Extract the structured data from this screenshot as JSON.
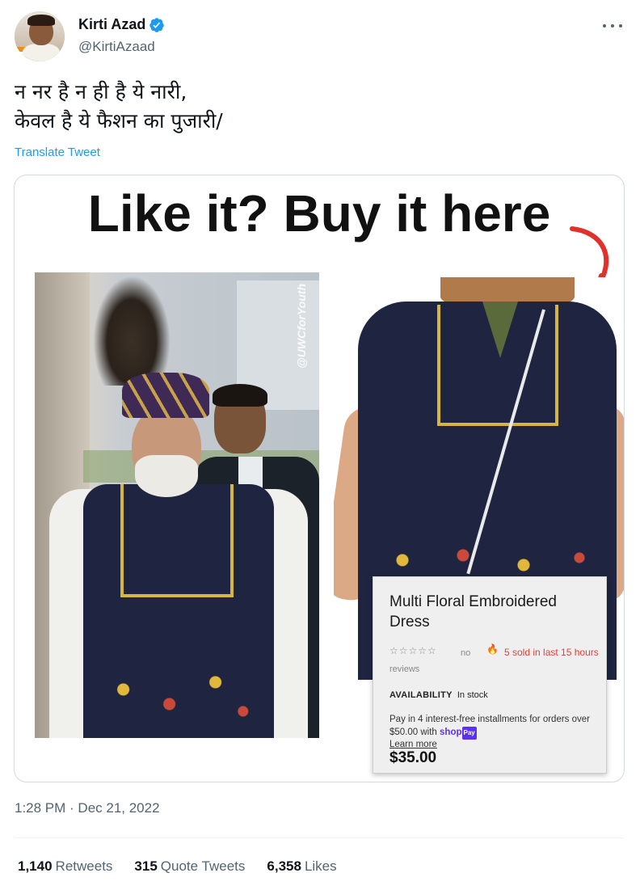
{
  "author": {
    "display_name": "Kirti Azad",
    "handle": "@KirtiAzaad",
    "verified": true,
    "avatar": "avatar-image"
  },
  "tweet": {
    "text_line1": "न नर है न ही है ये नारी,",
    "text_line2": "केवल है ये फैशन का पुजारी/",
    "translate_label": "Translate Tweet",
    "timestamp": "1:28 PM · Dec 21, 2022"
  },
  "media": {
    "headline": "Like it? Buy it here",
    "watermark": "@UWCforYouth",
    "product": {
      "title": "Multi Floral Embroidered Dress",
      "stars": "☆☆☆☆☆",
      "reviews": "no reviews",
      "fire_icon": "🔥",
      "sold": "5 sold in last 15 hours",
      "availability_label": "AVAILABILITY",
      "availability_value": "In stock",
      "pay_text": "Pay in 4 interest-free installments for orders over $50.00 with",
      "shop_label": "shop",
      "shop_pay_badge": "Pay",
      "learn_more": "Learn more",
      "price": "$35.00"
    }
  },
  "stats": {
    "retweets_count": "1,140",
    "retweets_label": "Retweets",
    "quotes_count": "315",
    "quotes_label": "Quote Tweets",
    "likes_count": "6,358",
    "likes_label": "Likes"
  },
  "colors": {
    "accent": "#1d9bf0",
    "secondary_text": "#536471",
    "arrow": "#e0312b"
  }
}
